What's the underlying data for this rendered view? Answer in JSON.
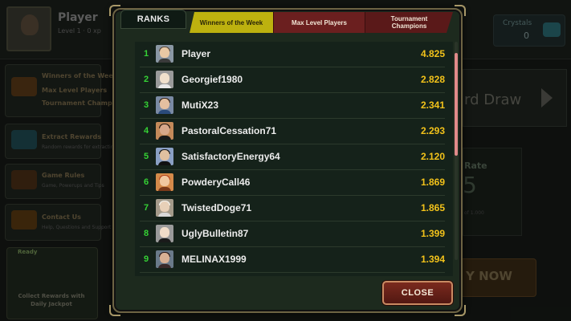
{
  "background": {
    "player_name": "Player",
    "level_text": "Level 1 · 0 xp",
    "crystals_label": "Crystals",
    "crystals_value": "0",
    "menu": [
      {
        "title": "Winners of the Week",
        "sub": "Max Level Players"
      },
      {
        "title": "Extract Rewards",
        "sub": "Random rewards for extracting"
      },
      {
        "title": "Game Rules",
        "sub": "Game, Powerups and Tips"
      },
      {
        "title": "Contact Us",
        "sub": "Help, Questions and Support"
      }
    ],
    "tournament_champions": "Tournament Champions",
    "ready_label": "Ready",
    "ready_text": "Collect Rewards with Daily Jackpot",
    "card_draw_label": "rd Draw",
    "rate_label": "Rate",
    "rate_value": "5",
    "rate_small": "of 1.000",
    "play_now_label": "Y NOW"
  },
  "modal": {
    "ranks_label": "RANKS",
    "tabs": [
      {
        "label": "Winners of the Week",
        "active": true
      },
      {
        "label": "Max Level Players",
        "active": false
      },
      {
        "label": "Tournament Champions",
        "active": false
      }
    ],
    "rows": [
      {
        "rank": "1",
        "name": "Player",
        "score": "4.825",
        "avatar": "avatar-player-icon"
      },
      {
        "rank": "2",
        "name": "Georgief1980",
        "score": "2.828",
        "avatar": "avatar-bald-man-icon"
      },
      {
        "rank": "3",
        "name": "MutiX23",
        "score": "2.341",
        "avatar": "avatar-man-glasses-icon"
      },
      {
        "rank": "4",
        "name": "PastoralCessation71",
        "score": "2.293",
        "avatar": "avatar-man-beard-icon"
      },
      {
        "rank": "5",
        "name": "SatisfactoryEnergy64",
        "score": "2.120",
        "avatar": "avatar-man-dark-icon"
      },
      {
        "rank": "6",
        "name": "PowderyCall46",
        "score": "1.869",
        "avatar": "avatar-redhead-icon"
      },
      {
        "rank": "7",
        "name": "TwistedDoge71",
        "score": "1.865",
        "avatar": "avatar-white-hair-icon"
      },
      {
        "rank": "8",
        "name": "UglyBulletin87",
        "score": "1.399",
        "avatar": "avatar-bald-man-2-icon"
      },
      {
        "rank": "9",
        "name": "MELINAX1999",
        "score": "1.394",
        "avatar": "avatar-woman-dark-icon"
      }
    ],
    "close_label": "CLOSE"
  },
  "colors": {
    "rank_number": "#35d235",
    "score": "#f2c21a",
    "active_tab": "#bdb10f",
    "inactive_tab": "#6b1f1f",
    "scroll_thumb": "#e08a8a"
  }
}
